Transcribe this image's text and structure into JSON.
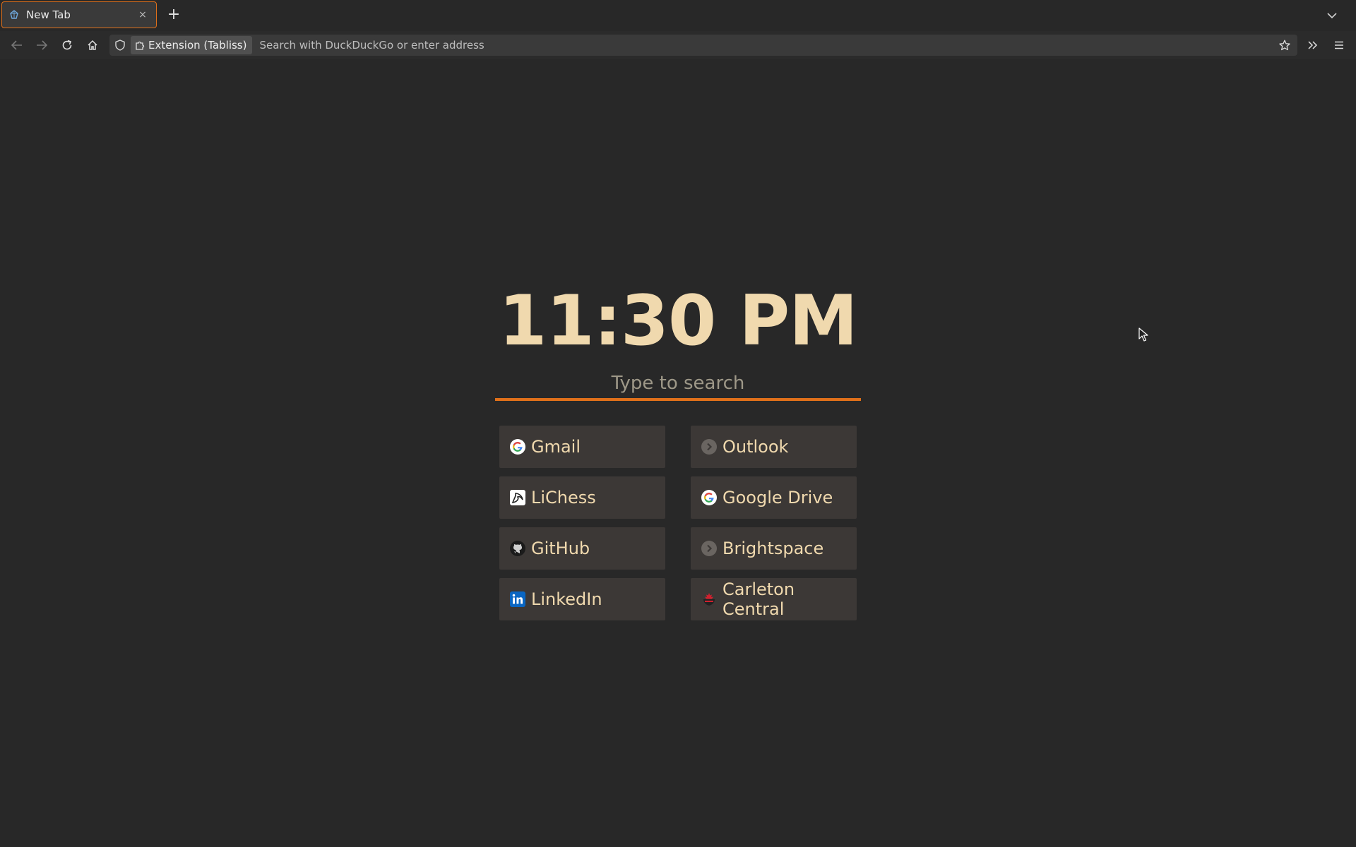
{
  "browser": {
    "tab": {
      "title": "New Tab",
      "close_symbol": "×"
    },
    "new_tab_symbol": "+",
    "extension_chip": "Extension (Tabliss)",
    "url_placeholder": "Search with DuckDuckGo or enter address"
  },
  "page": {
    "clock": "11:30 PM",
    "search_placeholder": "Type to search",
    "accent_color": "#e0701a",
    "links": [
      {
        "label": "Gmail",
        "icon": "google-icon"
      },
      {
        "label": "Outlook",
        "icon": "chevron-circle-icon"
      },
      {
        "label": "LiChess",
        "icon": "lichess-icon"
      },
      {
        "label": "Google Drive",
        "icon": "google-icon"
      },
      {
        "label": "GitHub",
        "icon": "github-icon"
      },
      {
        "label": "Brightspace",
        "icon": "chevron-circle-icon"
      },
      {
        "label": "LinkedIn",
        "icon": "linkedin-icon"
      },
      {
        "label": "Carleton Central",
        "icon": "carleton-icon"
      }
    ]
  }
}
